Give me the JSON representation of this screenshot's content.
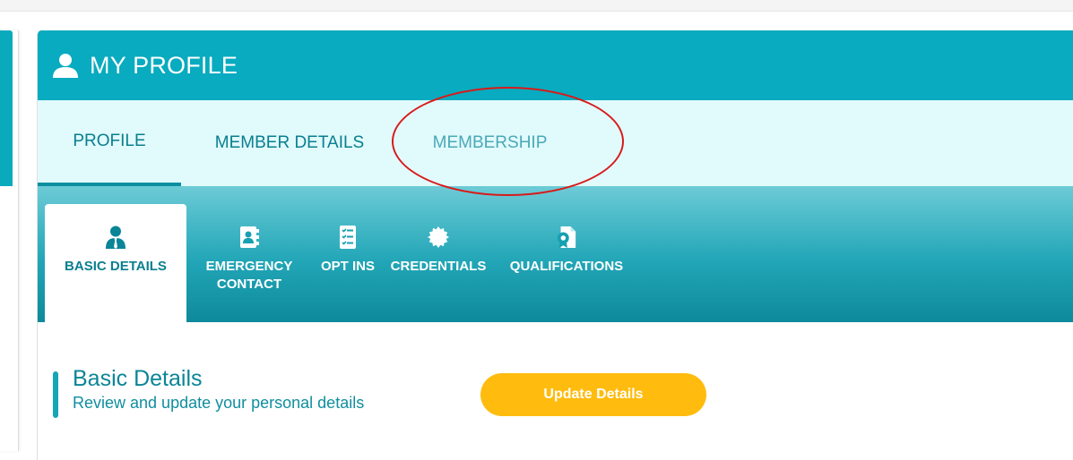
{
  "header": {
    "title": "MY PROFILE",
    "icon": "user-icon"
  },
  "tabs": [
    {
      "label": "PROFILE",
      "active": true
    },
    {
      "label": "MEMBER DETAILS",
      "active": false
    },
    {
      "label": "MEMBERSHIP",
      "active": false
    }
  ],
  "subtabs": [
    {
      "label": "BASIC DETAILS",
      "icon": "user-tie-icon",
      "active": true
    },
    {
      "label": "EMERGENCY CONTACT",
      "icon": "contact-card-icon",
      "active": false
    },
    {
      "label": "OPT INS",
      "icon": "checklist-icon",
      "active": false
    },
    {
      "label": "CREDENTIALS",
      "icon": "badge-icon",
      "active": false
    },
    {
      "label": "QUALIFICATIONS",
      "icon": "certificate-icon",
      "active": false
    }
  ],
  "section": {
    "title": "Basic Details",
    "subtitle": "Review and update your personal details",
    "button_label": "Update Details"
  },
  "colors": {
    "header": "#08abbf",
    "tab_bar": "#e1fafc",
    "accent": "#0a8597",
    "button": "#ffbc0f",
    "annotation": "#d81a1a"
  }
}
